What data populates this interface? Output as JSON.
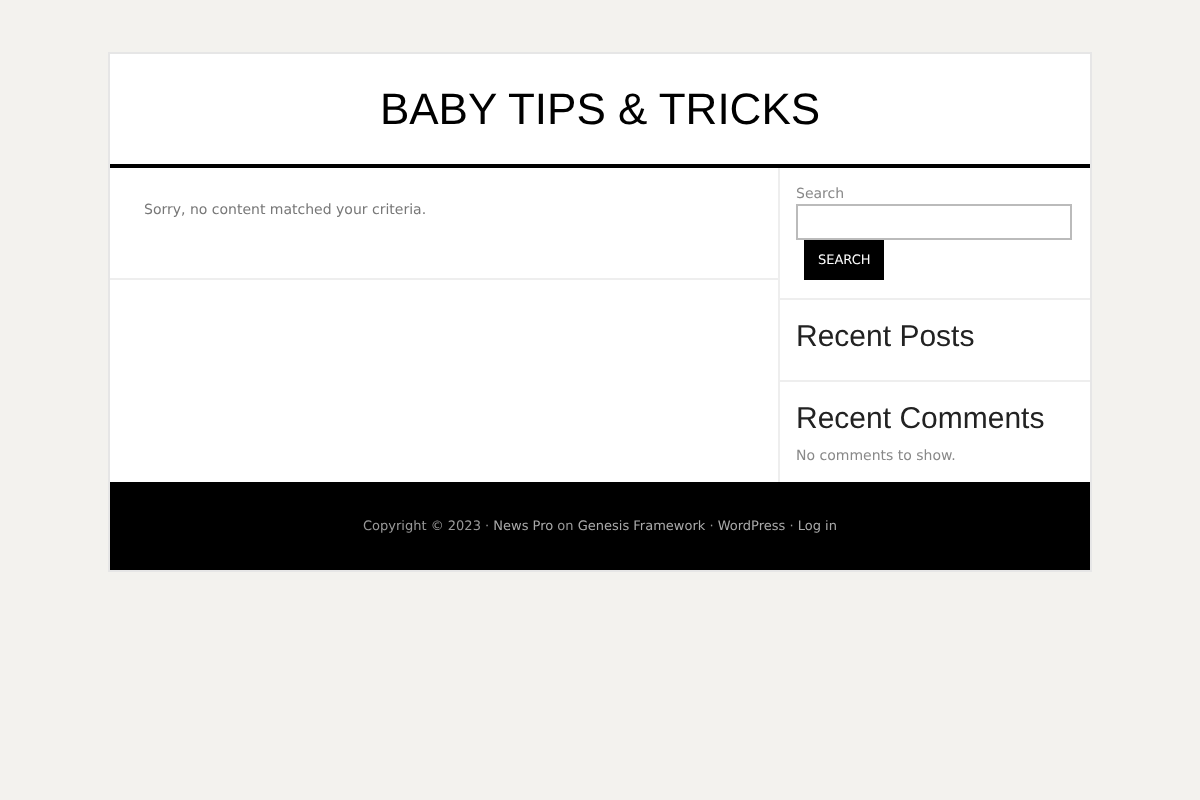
{
  "site_title": "BABY TIPS & TRICKS",
  "content": {
    "message": "Sorry, no content matched your criteria."
  },
  "sidebar": {
    "search": {
      "label": "Search",
      "button": "SEARCH"
    },
    "widgets": [
      {
        "title": "Recent Posts"
      },
      {
        "title": "Recent Comments",
        "text": "No comments to show."
      }
    ]
  },
  "footer": [
    {
      "kind": "text",
      "text": "Copyright © 2023 · "
    },
    {
      "kind": "link",
      "text": "News Pro"
    },
    {
      "kind": "text",
      "text": " on "
    },
    {
      "kind": "link",
      "text": "Genesis Framework"
    },
    {
      "kind": "text",
      "text": " · "
    },
    {
      "kind": "link",
      "text": "WordPress"
    },
    {
      "kind": "text",
      "text": " · "
    },
    {
      "kind": "link",
      "text": "Log in"
    }
  ]
}
